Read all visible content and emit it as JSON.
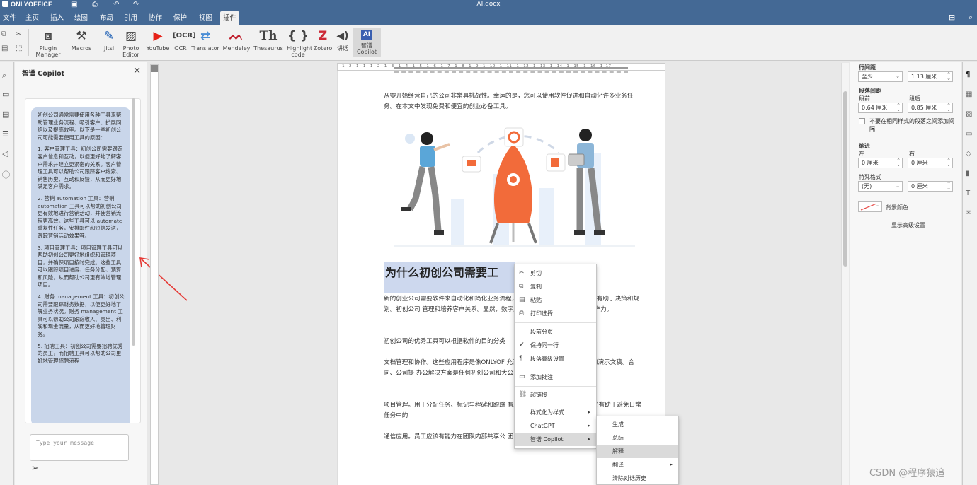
{
  "titlebar": {
    "app": "ONLYOFFICE",
    "document": "AI.docx"
  },
  "menu": {
    "tabs": [
      "文件",
      "主页",
      "插入",
      "绘图",
      "布局",
      "引用",
      "协作",
      "保护",
      "视图",
      "插件"
    ],
    "active_tab": "插件"
  },
  "toolbar": {
    "plugin_manager": "Plugin Manager",
    "macros": "Macros",
    "jitsi": "Jitsi",
    "photo_editor": "Photo Editor",
    "youtube": "YouTube",
    "ocr": "OCR",
    "translator": "Translator",
    "mendeley": "Mendeley",
    "thesaurus": "Thesaurus",
    "highlight_code": "Highlight code",
    "zotero": "Zotero",
    "speech": "讲话",
    "copilot": "智谱 Copilot"
  },
  "copilot_panel": {
    "title": "智谱 Copilot",
    "message_placeholder": "Type your message",
    "reply_paragraphs": [
      "初创公司通常需要使用各种工具来帮助管理业务流程、吸引客户、扩展网络以及提高效率。以下是一些初创公司可能需要使用工具的原因：",
      "1. 客户管理工具：初创公司需要跟踪客户信息和互动，以便更好地了解客户需求并建立更紧密的关系。客户管理工具可以帮助公司跟踪客户线索、销售历史、互动和反馈，从而更好地满足客户需求。",
      "2. 营销 automation 工具：营销 automation 工具可以帮助初创公司更有效地进行营销活动，并使营销流程更高效。这些工具可以 automate 重复性任务，安排邮件和短信发送，跟踪营销活动效果等。",
      "3. 项目管理工具：项目管理工具可以帮助初创公司更好地组织和管理项目，并确保项目按时完成。这些工具可以跟踪项目进度、任务分配、预算和风险，从而帮助公司更有效地管理项目。",
      "4. 财务 management 工具：初创公司需要跟踪财务数据，以便更好地了解业务状况。财务 management 工具可以帮助公司跟踪收入、支出、利润和现金流量，从而更好地管理财务。",
      "5. 招聘工具：初创公司需要招聘优秀的员工，而招聘工具可以帮助公司更好地管理招聘流程"
    ]
  },
  "ruler": {
    "horizontal": "· 1 · 2 · 1 · 1 · 1 · 2 · 1 · 3 · 1 · 4 · 1 · 5 · 1 · 6 · 1 · 7 · 1 · 8 · 1 · 9 · 1 · 10 · 1 · 11 · 1 · 12 · 1 · 13 · 1 · 14 · 1 · 15 · 1 · 16 · 1 ·17 ·"
  },
  "document": {
    "intro": "从零开始经营自己的公司非常具挑战性。幸运的是，您可以使用软件促进和自动化许多业务任务。在本文中发现免费和便宜的创业必备工具。",
    "heading": "为什么初创公司需要工",
    "p1": "新的创业公司需要软件来自动化和简化业务流程，工具提供有价值的数据见解，有助于决策和规划。初创公司 管理和培养客户关系。显然，数字解决方案增强了团队内部 和生产力。",
    "p2": "初创公司的优秀工具可以根据软件的目的分类",
    "p3": "文档管理和协作。这些应用程序是像ONLYOF 允许创建和编辑文本、电子表格和演示文稿。合同、公司提 办公解决方案是任何初创公司和大公司的必备品。",
    "p4": "项目管理。用于分配任务、标记里程碑和跟踪 有助于可视化启动进度，计划活动有助于避免日常任务中的",
    "p5": "通信应用。员工应该有能力在团队内部共享公 团队中，对这种类型的工具变得特别需要。"
  },
  "context_menu": {
    "items": [
      "剪切",
      "复制",
      "粘贴",
      "打印选择",
      "段前分页",
      "保持同一行",
      "段落高级设置",
      "添加批注",
      "超链接",
      "样式化为样式",
      "ChatGPT",
      "智谱 Copilot"
    ]
  },
  "submenu": {
    "items": [
      "生成",
      "总结",
      "解释",
      "翻译",
      "清除对话历史"
    ],
    "highlighted": "解释"
  },
  "right_panel": {
    "line_spacing_label": "行间距",
    "line_spacing_mode": "至少",
    "line_spacing_value": "1.13 厘米",
    "paragraph_spacing_label": "段落间距",
    "before_label": "段前",
    "after_label": "段后",
    "before_value": "0.64 厘米",
    "after_value": "0.85 厘米",
    "no_space_same_style": "不要在相同样式的段落之间添加间隔",
    "indent_label": "缩进",
    "left_label": "左",
    "right_label": "右",
    "left_value": "0 厘米",
    "right_value": "0 厘米",
    "special_label": "特殊格式",
    "special_value": "(无)",
    "special_amount": "0 厘米",
    "background_color": "背景颜色",
    "show_advanced": "显示高级设置"
  },
  "watermark": "CSDN @程序猿追",
  "colors": {
    "header": "#446995",
    "bubble": "#c9d6ea",
    "heading_highlight": "#cdd8ee",
    "annotation_arrow": "#e53935",
    "rocket": "#f26b3a",
    "figure_blue": "#5aa6d8"
  }
}
